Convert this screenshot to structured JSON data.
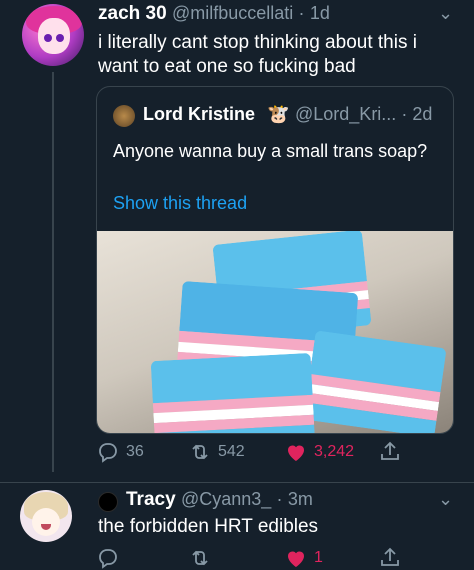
{
  "tweet1": {
    "name": "zach 30",
    "handle": "@milfbuccellati",
    "sep": "·",
    "time": "1d",
    "text": "i literally cant stop thinking about this i want to eat one so fucking bad",
    "quote": {
      "name": "Lord Kristine",
      "emoji": "🐮",
      "handle": "@Lord_Kri...",
      "sep": "·",
      "time": "2d",
      "text": "Anyone wanna buy a small trans soap?",
      "show_thread": "Show this thread"
    },
    "actions": {
      "replies": "36",
      "retweets": "542",
      "likes": "3,242"
    }
  },
  "tweet2": {
    "name": "Tracy",
    "handle": "@Cyann3_",
    "sep": "·",
    "time": "3m",
    "text": "the forbidden HRT edibles",
    "actions": {
      "replies": "",
      "retweets": "",
      "likes": "1"
    }
  },
  "colors": {
    "background": "#15202b",
    "secondary_text": "#8899a6",
    "link": "#1da1f2",
    "like": "#e0245e",
    "soap_blue": "#5bc0eb",
    "soap_pink": "#f5a9c4",
    "soap_white": "#ffffff"
  },
  "icons": {
    "reply": "reply-icon",
    "retweet": "retweet-icon",
    "like": "heart-icon",
    "share": "share-icon",
    "more": "chevron-down-icon"
  }
}
